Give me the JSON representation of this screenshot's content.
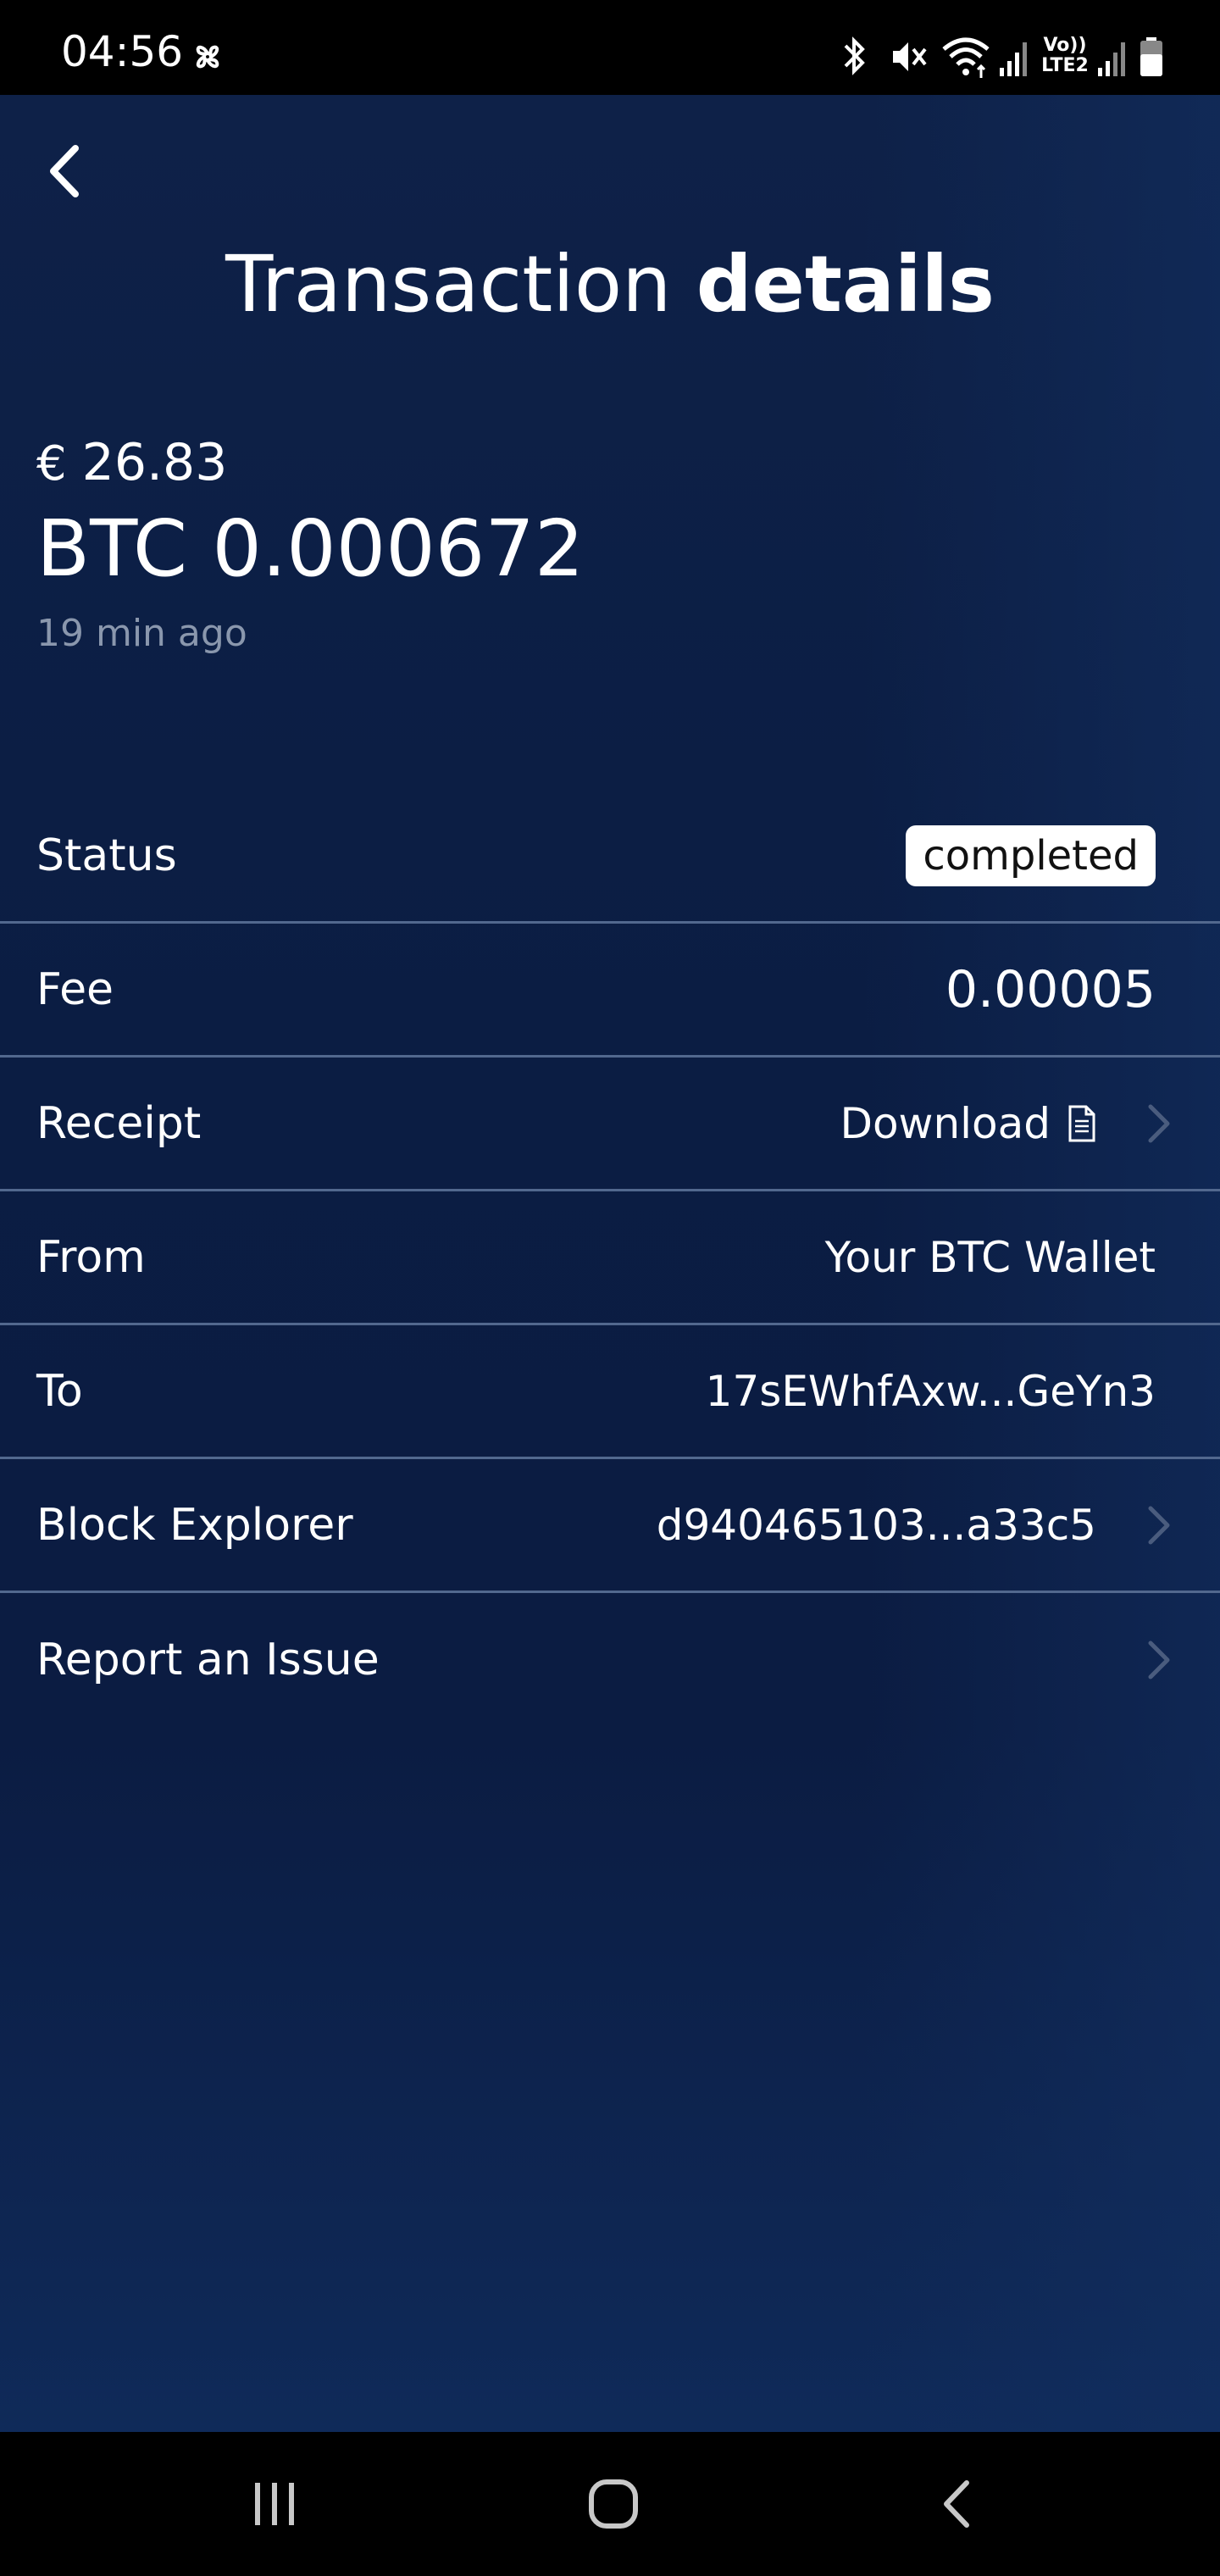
{
  "status_bar": {
    "time": "04:56",
    "left_icon": "pinwheel-icon",
    "icons": [
      "bluetooth-icon",
      "mute-icon",
      "wifi-icon",
      "signal-icon",
      "volte-lte2-icon",
      "signal-icon",
      "battery-icon"
    ],
    "volte_label": "Vo))",
    "lte_label": "LTE2"
  },
  "header": {
    "title_regular": "Transaction",
    "title_bold": "details"
  },
  "summary": {
    "currency_symbol": "€",
    "fiat_amount": "26.83",
    "crypto_amount": "BTC 0.000672",
    "time_ago": "19 min ago"
  },
  "details": {
    "status_label": "Status",
    "status_value": "completed",
    "fee_label": "Fee",
    "fee_value": "0.00005",
    "receipt_label": "Receipt",
    "receipt_value": "Download",
    "from_label": "From",
    "from_value": "Your BTC Wallet",
    "to_label": "To",
    "to_value": "17sEWhfAxw...GeYn3",
    "explorer_label": "Block Explorer",
    "explorer_value": "d940465103...a33c5",
    "report_label": "Report an Issue"
  },
  "colors": {
    "background": "#0b1d43",
    "divider": "#52688e",
    "muted_text": "#8a97ad",
    "badge_bg": "#ffffff"
  }
}
